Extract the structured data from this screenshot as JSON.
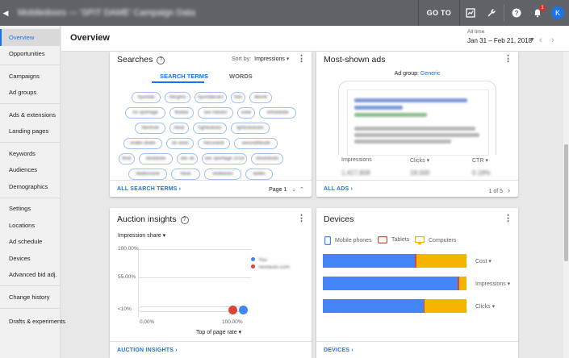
{
  "topbar": {
    "account_title": "Mobiledoors — 'SPIT DAME' Campaign Data",
    "goto_label": "GO TO",
    "avatar_letter": "K",
    "notification_count": "1"
  },
  "sidebar": {
    "groups": [
      [
        {
          "label": "Overview",
          "active": true
        },
        {
          "label": "Opportunities"
        }
      ],
      [
        {
          "label": "Campaigns"
        },
        {
          "label": "Ad groups"
        }
      ],
      [
        {
          "label": "Ads & extensions"
        },
        {
          "label": "Landing pages"
        }
      ],
      [
        {
          "label": "Keywords"
        },
        {
          "label": "Audiences"
        },
        {
          "label": "Demographics"
        }
      ],
      [
        {
          "label": "Settings"
        },
        {
          "label": "Locations"
        },
        {
          "label": "Ad schedule"
        },
        {
          "label": "Devices"
        },
        {
          "label": "Advanced bid adj."
        }
      ],
      [
        {
          "label": "Change history"
        }
      ],
      [
        {
          "label": "Drafts & experiments"
        }
      ]
    ]
  },
  "header": {
    "title": "Overview",
    "date_label": "All time",
    "date_range": "Jan 31 – Feb 21, 2018"
  },
  "searches": {
    "title": "Searches",
    "sort_by_label": "Sort by:",
    "sort_by_value": "Impressions",
    "tabs": [
      "SEARCH TERMS",
      "WORDS"
    ],
    "terms": [
      [
        "hyundai",
        "hbcgms",
        "hyundaicars",
        "hdo",
        "dbsnk"
      ],
      [
        "no sportage",
        "fbxkbx",
        "sex hdsdsr",
        "sxbe",
        "shfsbdsbk"
      ],
      [
        "hbmhxb",
        "hbsb",
        "hghbsbsbs",
        "fghbsbsbsbs"
      ],
      [
        "shdbs ibsbn",
        "sb sdsb",
        "hbcsndsb",
        "sexsndhbsdb"
      ],
      [
        "fbsb",
        "sbsbdsbs",
        "sbs sb",
        "sex sportage 2018",
        "sbsdsbsds"
      ],
      [
        "hbdbsndsb",
        "hbsb",
        "sbdbdsbs",
        "sbdbs"
      ]
    ],
    "footer_link": "ALL SEARCH TERMS",
    "page_label": "Page 1"
  },
  "ads": {
    "title": "Most-shown ads",
    "ad_group_label": "Ad group:",
    "ad_group_value": "Generic",
    "stats": [
      {
        "label": "Impressions",
        "value": "1,417,808"
      },
      {
        "label": "Clicks",
        "value": "18,000"
      },
      {
        "label": "CTR",
        "value": "0.18%"
      }
    ],
    "footer_link": "ALL ADS",
    "pager": "1 of 5"
  },
  "auction": {
    "title": "Auction insights",
    "metric_dropdown": "Impression share",
    "y_ticks": [
      "100.00%",
      "55.00%",
      "<10%"
    ],
    "x_ticks": [
      "0.00%",
      "100.00%"
    ],
    "x_selector": "Top of page rate",
    "legend": [
      {
        "name": "You",
        "color": "#4285f4"
      },
      {
        "name": "nextauto.com",
        "color": "#db4437"
      }
    ],
    "footer_link": "AUCTION INSIGHTS",
    "chart_data": {
      "type": "scatter",
      "xlabel": "Top of page rate",
      "ylabel": "Impression share",
      "series": [
        {
          "name": "You",
          "x": 1.0,
          "y": 0.1
        },
        {
          "name": "nextauto.com",
          "x": 0.9,
          "y": 0.1
        }
      ]
    }
  },
  "devices": {
    "title": "Devices",
    "legend": [
      {
        "name": "Mobile phones",
        "color": "#4285f4",
        "icon": "phone-icon"
      },
      {
        "name": "Tablets",
        "color": "#db4437",
        "icon": "tablet-icon"
      },
      {
        "name": "Computers",
        "color": "#f4b400",
        "icon": "computer-icon"
      }
    ],
    "metrics": [
      "Cost",
      "Impressions",
      "Clicks"
    ],
    "chart_data": {
      "type": "bar",
      "categories": [
        "Cost",
        "Impressions",
        "Clicks"
      ],
      "series": [
        {
          "name": "Mobile phones",
          "values": [
            0.64,
            0.94,
            0.7
          ]
        },
        {
          "name": "Tablets",
          "values": [
            0.01,
            0.01,
            0.01
          ]
        },
        {
          "name": "Computers",
          "values": [
            0.35,
            0.05,
            0.29
          ]
        }
      ]
    },
    "footer_link": "DEVICES"
  }
}
